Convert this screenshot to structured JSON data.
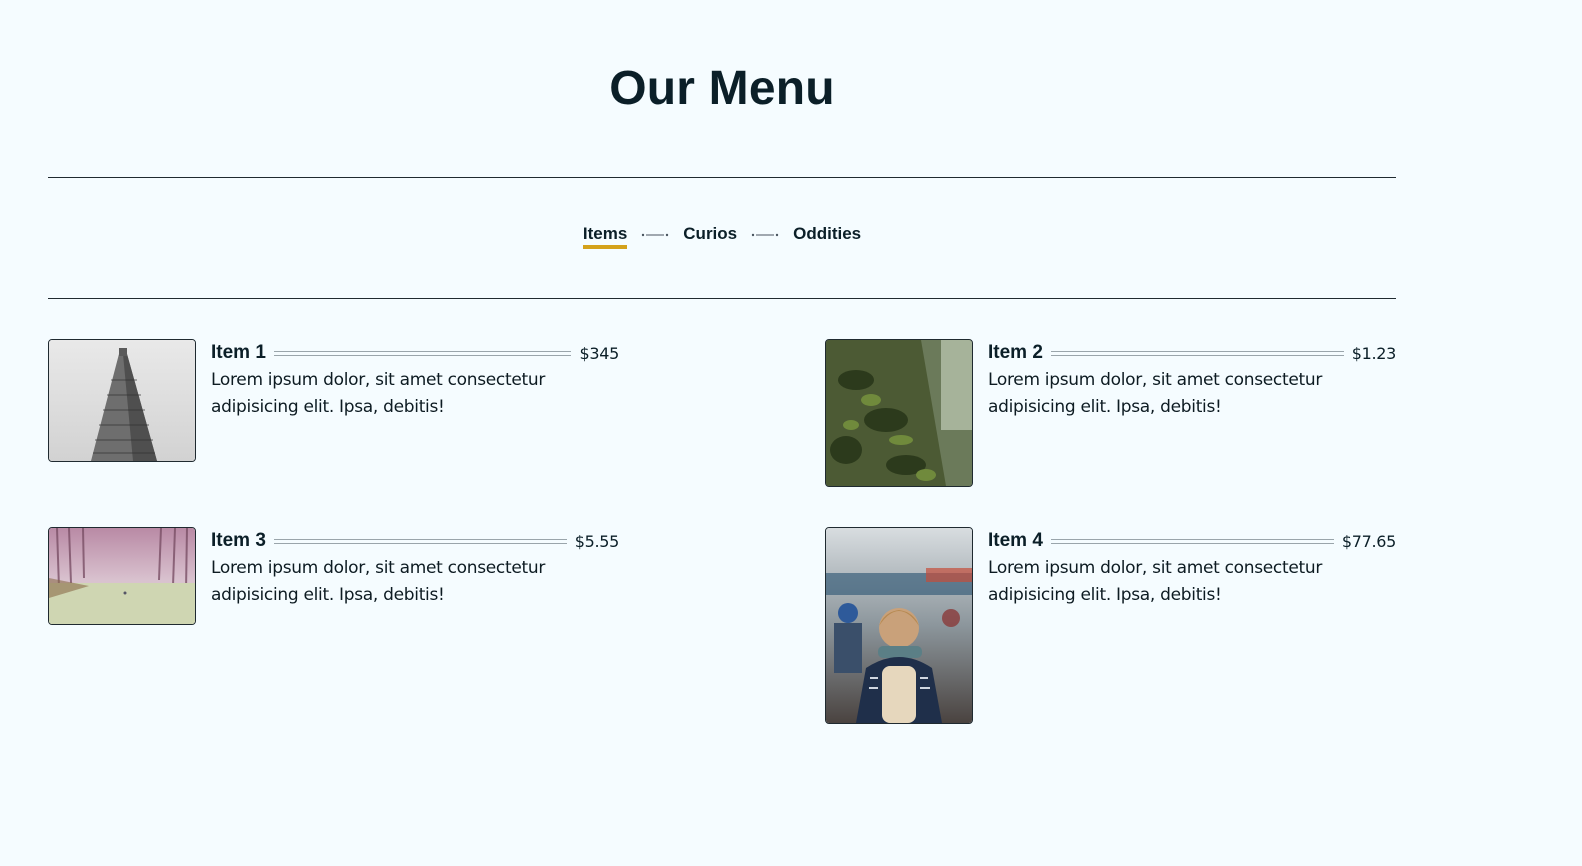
{
  "page": {
    "title": "Our Menu"
  },
  "tabs": [
    {
      "label": "Items",
      "active": true
    },
    {
      "label": "Curios",
      "active": false
    },
    {
      "label": "Oddities",
      "active": false
    }
  ],
  "colors": {
    "background": "#f5fcff",
    "text": "#0b1f28",
    "accent": "#d4a21b"
  },
  "items": [
    {
      "name": "Item 1",
      "price": "$345",
      "description": "Lorem ipsum dolor, sit amet consectetur adipisicing elit. Ipsa, debitis!",
      "image": "flatiron-building-photo"
    },
    {
      "name": "Item 2",
      "price": "$1.23",
      "description": "Lorem ipsum dolor, sit amet consectetur adipisicing elit. Ipsa, debitis!",
      "image": "mossy-tree-bark-photo"
    },
    {
      "name": "Item 3",
      "price": "$5.55",
      "description": "Lorem ipsum dolor, sit amet consectetur adipisicing elit. Ipsa, debitis!",
      "image": "misty-forest-path-photo"
    },
    {
      "name": "Item 4",
      "price": "$77.65",
      "description": "Lorem ipsum dolor, sit amet consectetur adipisicing elit. Ipsa, debitis!",
      "image": "person-backpack-street-photo"
    }
  ]
}
